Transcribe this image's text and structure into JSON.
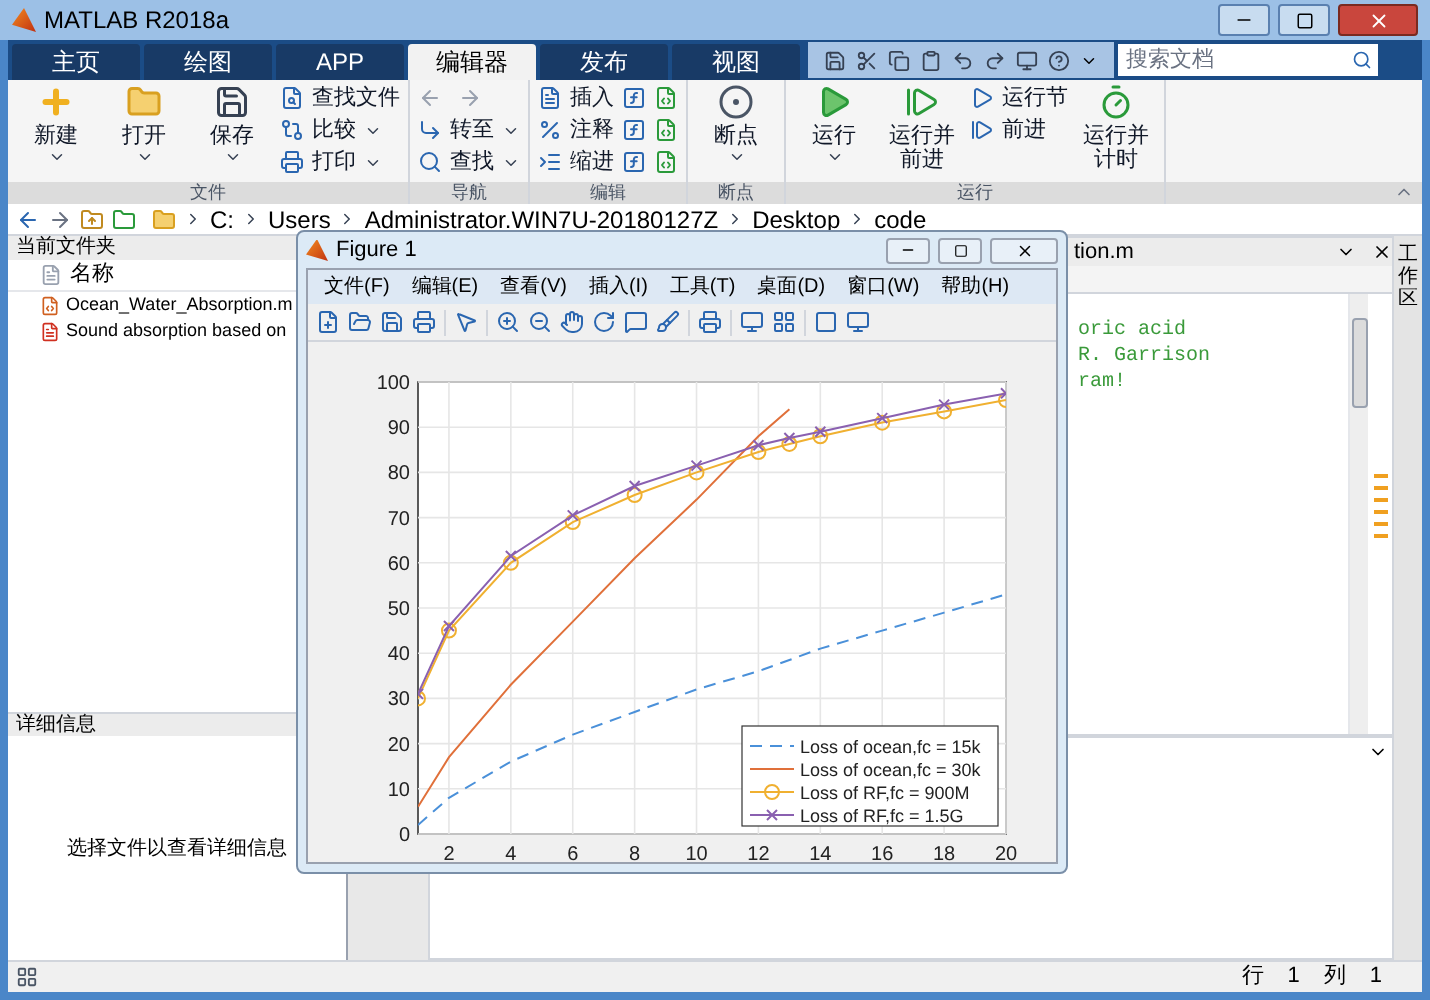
{
  "window": {
    "title": "MATLAB R2018a"
  },
  "tabs": [
    {
      "label": "主页",
      "selected": false
    },
    {
      "label": "绘图",
      "selected": false
    },
    {
      "label": "APP",
      "selected": false
    },
    {
      "label": "编辑器",
      "selected": true
    },
    {
      "label": "发布",
      "selected": false
    },
    {
      "label": "视图",
      "selected": false
    }
  ],
  "search": {
    "placeholder": "搜索文档"
  },
  "ribbon": {
    "groups": [
      {
        "label": "文件",
        "large": [
          {
            "label": "新建",
            "dropdown": true
          },
          {
            "label": "打开",
            "dropdown": true
          },
          {
            "label": "保存",
            "dropdown": true
          }
        ],
        "small": [
          {
            "label": "查找文件",
            "dropdown": false
          },
          {
            "label": "比较",
            "dropdown": true
          },
          {
            "label": "打印",
            "dropdown": true
          }
        ]
      },
      {
        "label": "导航",
        "small": [
          {
            "label": "转至",
            "dropdown": true
          },
          {
            "label": "查找",
            "dropdown": true
          }
        ]
      },
      {
        "label": "编辑",
        "small": [
          {
            "label": "插入",
            "dropdown": false
          },
          {
            "label": "注释",
            "dropdown": false
          },
          {
            "label": "缩进",
            "dropdown": false
          }
        ]
      },
      {
        "label": "断点",
        "large": [
          {
            "label": "断点",
            "dropdown": true
          }
        ]
      },
      {
        "label": "运行",
        "large": [
          {
            "label": "运行",
            "dropdown": true
          },
          {
            "label": "运行并前进",
            "dropdown": false
          }
        ],
        "small": [
          {
            "label": "运行节",
            "dropdown": false
          },
          {
            "label": "前进",
            "dropdown": false
          }
        ],
        "large_after": [
          {
            "label": "运行并计时",
            "dropdown": false
          }
        ]
      }
    ]
  },
  "address_bar": {
    "segments": [
      "C:",
      "Users",
      "Administrator.WIN7U-20180127Z",
      "Desktop",
      "code"
    ]
  },
  "current_folder": {
    "title": "当前文件夹",
    "column": "名称",
    "files": [
      {
        "name": "Ocean_Water_Absorption.m",
        "kind": "script"
      },
      {
        "name": "Sound absorption based on",
        "kind": "pdf"
      }
    ]
  },
  "details": {
    "title": "详细信息",
    "message": "选择文件以查看详细信息"
  },
  "editor": {
    "tab": "tion.m",
    "lines": [
      "oric acid",
      "R. Garrison",
      "ram!"
    ]
  },
  "side_tab": {
    "label": "工作区"
  },
  "status_bar": {
    "row_label": "行",
    "row": "1",
    "col_label": "列",
    "col": "1"
  },
  "figure": {
    "title": "Figure 1",
    "menu": [
      "文件(F)",
      "编辑(E)",
      "查看(V)",
      "插入(I)",
      "工具(T)",
      "桌面(D)",
      "窗口(W)",
      "帮助(H)"
    ],
    "chart_data": {
      "type": "line",
      "x": [
        1,
        2,
        4,
        6,
        8,
        10,
        12,
        13,
        14,
        16,
        18,
        20
      ],
      "xlim": [
        1,
        20
      ],
      "ylim": [
        0,
        100
      ],
      "grid": true,
      "legend": true,
      "xticks": [
        2,
        4,
        6,
        8,
        10,
        12,
        14,
        16,
        18,
        20
      ],
      "yticks": [
        0,
        10,
        20,
        30,
        40,
        50,
        60,
        70,
        80,
        90,
        100
      ],
      "series": [
        {
          "name": "Loss of ocean,fc = 15k",
          "color": "#4a90d9",
          "line_style": "dashed",
          "values": [
            2,
            8,
            16,
            22,
            27,
            32,
            36,
            38.5,
            41,
            45,
            49,
            53
          ]
        },
        {
          "name": "Loss of ocean,fc = 30k",
          "color": "#e0703a",
          "line_style": "solid",
          "values": [
            6,
            17,
            33,
            47,
            61,
            74,
            88,
            94,
            null,
            null,
            null,
            null
          ]
        },
        {
          "name": "Loss of RF,fc = 900M",
          "color": "#f0b030",
          "line_style": "solid",
          "marker": "o",
          "values": [
            30,
            45,
            60,
            69,
            75,
            80,
            84.5,
            86.3,
            88,
            91,
            93.5,
            96
          ]
        },
        {
          "name": "Loss of RF,fc = 1.5G",
          "color": "#8a60b0",
          "line_style": "solid",
          "marker": "x",
          "values": [
            31,
            46,
            61.5,
            70.5,
            77,
            81.5,
            86,
            87.6,
            89,
            92,
            95,
            97.5
          ]
        }
      ]
    }
  }
}
